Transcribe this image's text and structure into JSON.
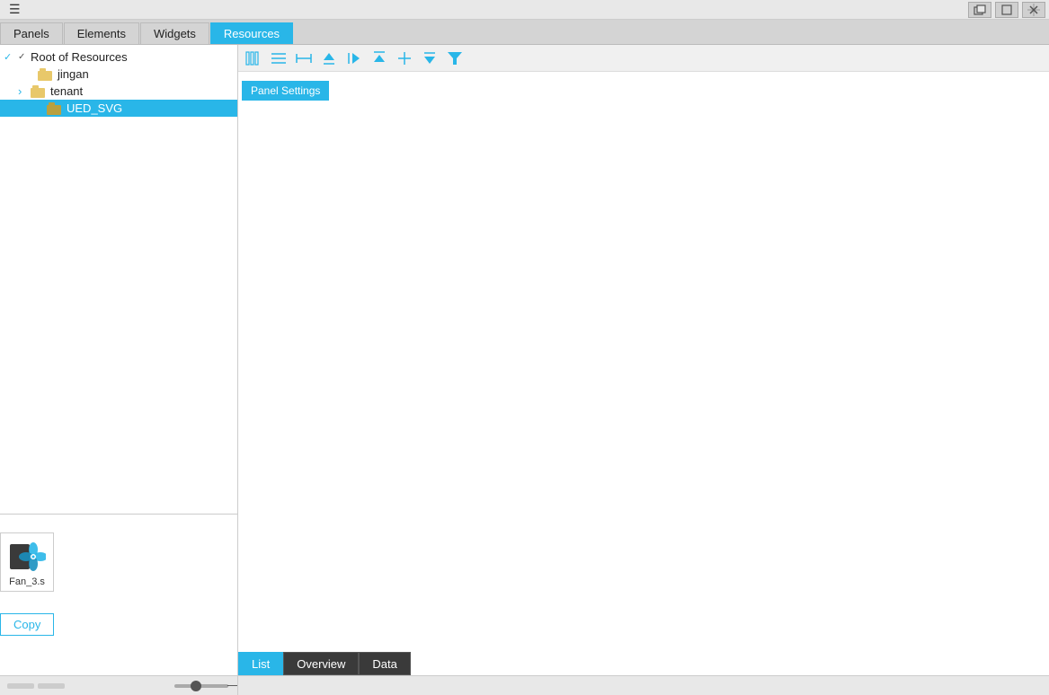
{
  "menubar": {
    "hamburger": "☰"
  },
  "windowControls": {
    "restore": "⧉",
    "maximize": "□",
    "cross": "✛"
  },
  "tabs": [
    {
      "id": "panels",
      "label": "Panels",
      "active": false
    },
    {
      "id": "elements",
      "label": "Elements",
      "active": false
    },
    {
      "id": "widgets",
      "label": "Widgets",
      "active": false
    },
    {
      "id": "resources",
      "label": "Resources",
      "active": true
    }
  ],
  "tree": {
    "rootLabel": "Root of Resources",
    "items": [
      {
        "id": "jingan",
        "label": "jingan",
        "indent": 1,
        "hasArrow": false,
        "arrowChar": ""
      },
      {
        "id": "tenant",
        "label": "tenant",
        "indent": 1,
        "hasArrow": true,
        "arrowChar": "›"
      },
      {
        "id": "ued_svg",
        "label": "UED_SVG",
        "indent": 2,
        "hasArrow": false,
        "arrowChar": "",
        "selected": true
      }
    ]
  },
  "preview": {
    "dragLabel": "Fan_3.s",
    "copyLabel": "Copy"
  },
  "rightToolbar": {
    "icons": [
      "▐▐",
      "≡",
      "◁",
      "▲",
      "▶",
      "▲▲",
      "↑",
      "↓",
      "▽"
    ],
    "filterIcon": "▼"
  },
  "panelSettings": {
    "label": "Panel Settings"
  },
  "rightTabs": [
    {
      "id": "list",
      "label": "List",
      "active": true
    },
    {
      "id": "overview",
      "label": "Overview",
      "active": false
    },
    {
      "id": "data",
      "label": "Data",
      "active": false
    }
  ],
  "slider": {
    "value": 40
  }
}
